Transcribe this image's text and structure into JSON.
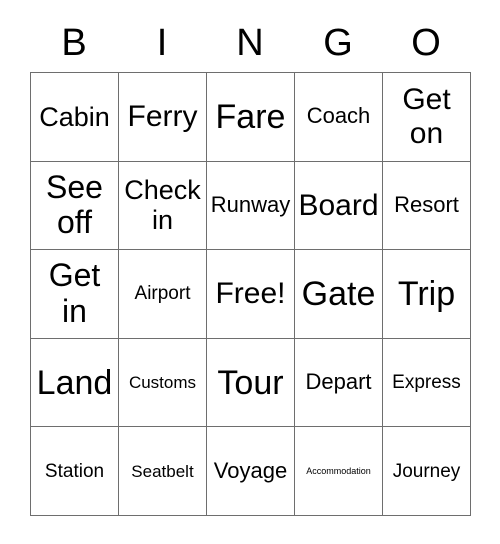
{
  "card": {
    "header_letters": [
      "B",
      "I",
      "N",
      "G",
      "O"
    ],
    "columns": 5,
    "rows": 5,
    "border_color": "#6e6e6e",
    "text_color": "#000000",
    "background_color": "#ffffff",
    "cells": [
      [
        {
          "text": "Cabin",
          "size": "md"
        },
        {
          "text": "Ferry",
          "size": "lg"
        },
        {
          "text": "Fare",
          "size": "xxl"
        },
        {
          "text": "Coach",
          "size": "sm"
        },
        {
          "text": "Get\non",
          "size": "lg"
        }
      ],
      [
        {
          "text": "See\noff",
          "size": "xl"
        },
        {
          "text": "Check\nin",
          "size": "md"
        },
        {
          "text": "Runway",
          "size": "sm"
        },
        {
          "text": "Board",
          "size": "lg"
        },
        {
          "text": "Resort",
          "size": "sm"
        }
      ],
      [
        {
          "text": "Get\nin",
          "size": "xl"
        },
        {
          "text": "Airport",
          "size": "xs"
        },
        {
          "text": "Free!",
          "size": "lg"
        },
        {
          "text": "Gate",
          "size": "xxl"
        },
        {
          "text": "Trip",
          "size": "xxl"
        }
      ],
      [
        {
          "text": "Land",
          "size": "xxl"
        },
        {
          "text": "Customs",
          "size": "xxs"
        },
        {
          "text": "Tour",
          "size": "xxl"
        },
        {
          "text": "Depart",
          "size": "sm"
        },
        {
          "text": "Express",
          "size": "xs"
        }
      ],
      [
        {
          "text": "Station",
          "size": "xs"
        },
        {
          "text": "Seatbelt",
          "size": "xxs"
        },
        {
          "text": "Voyage",
          "size": "sm"
        },
        {
          "text": "Accommodation",
          "size": "tiny"
        },
        {
          "text": "Journey",
          "size": "xs"
        }
      ]
    ]
  }
}
